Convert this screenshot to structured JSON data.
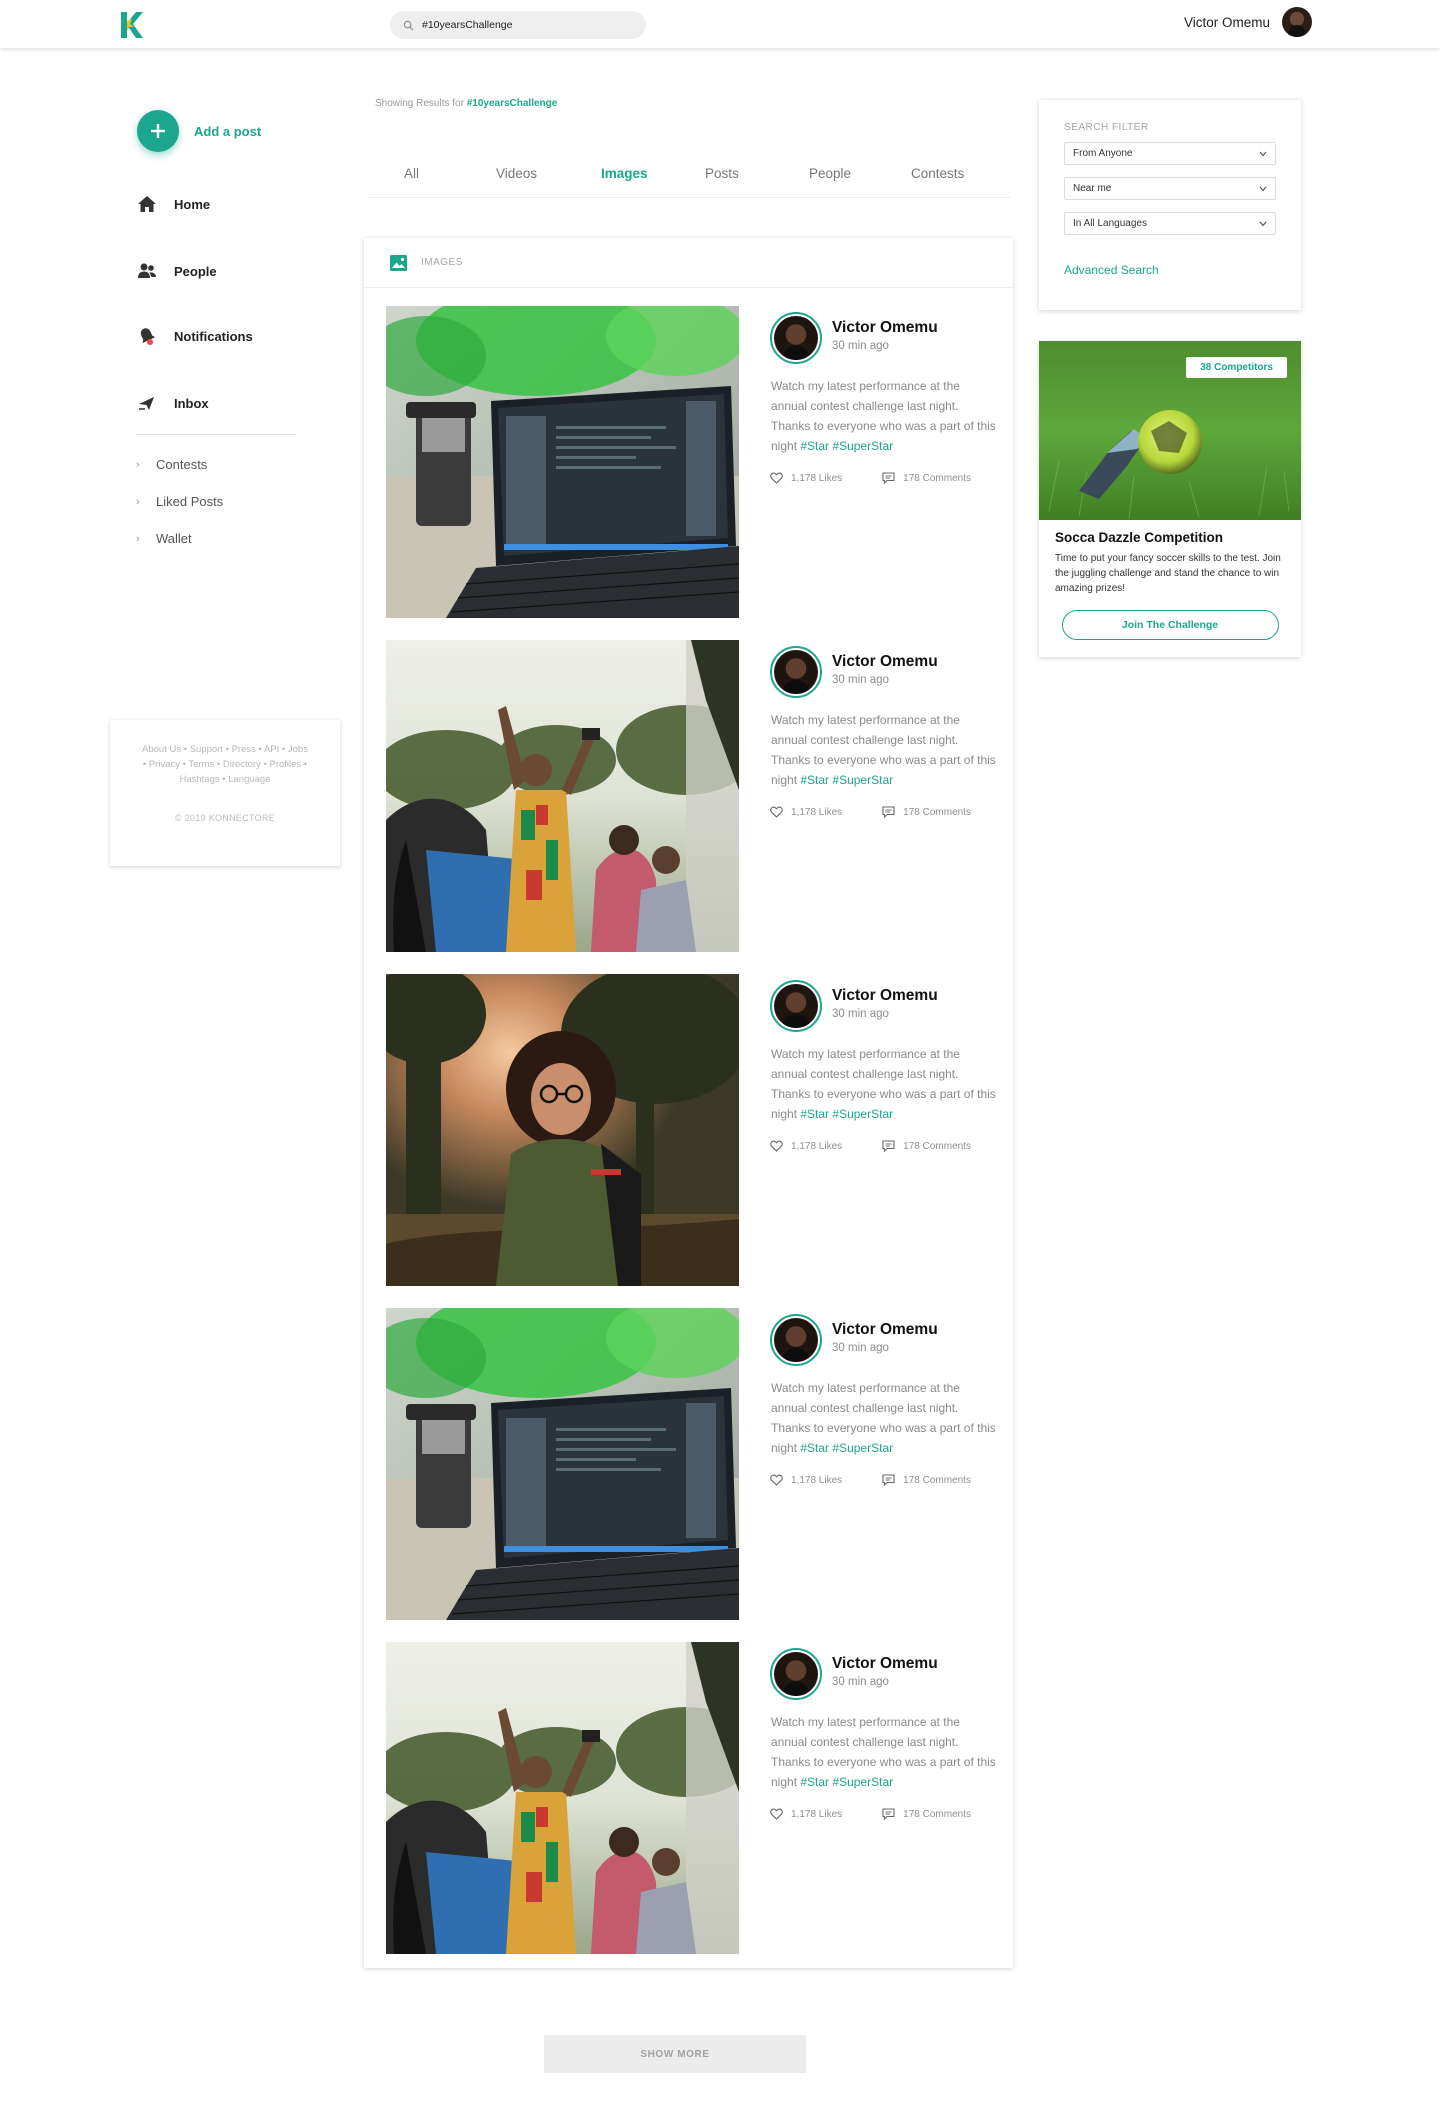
{
  "header": {
    "logo_letter": "K",
    "search_value": "#10yearsChallenge",
    "user_name": "Victor Omemu"
  },
  "sidebar": {
    "add_post_label": "Add a post",
    "nav_items": [
      {
        "label": "Home",
        "icon": "home-icon"
      },
      {
        "label": "People",
        "icon": "people-icon"
      },
      {
        "label": "Notifications",
        "icon": "notifications-icon"
      },
      {
        "label": "Inbox",
        "icon": "inbox-icon"
      }
    ],
    "sub_items": [
      {
        "label": "Contests"
      },
      {
        "label": "Liked Posts"
      },
      {
        "label": "Wallet"
      }
    ],
    "footer": {
      "links_line1": "About Us • Support • Press • API • Jobs",
      "links_line2": "• Privacy • Terms • Directory • Profiles •",
      "links_line3": "Hashtags • Language",
      "copyright": "© 2019 KONNECTORE"
    }
  },
  "results": {
    "showing_prefix": "Showing Results for",
    "query": "#10yearsChallenge",
    "tabs": [
      {
        "label": "All"
      },
      {
        "label": "Videos"
      },
      {
        "label": "Images",
        "active": true
      },
      {
        "label": "Posts"
      },
      {
        "label": "People"
      },
      {
        "label": "Contests"
      }
    ],
    "section_title": "IMAGES",
    "posts": [
      {
        "image": "laptop",
        "author": "Victor Omemu",
        "time": "30 min ago",
        "text": "Watch my latest performance at the annual contest challenge last night. Thanks to everyone who was a part of this night",
        "tag1": "#Star",
        "tag2": "#SuperStar",
        "likes": "1,178 Likes",
        "comments": "178 Comments"
      },
      {
        "image": "crowd",
        "author": "Victor Omemu",
        "time": "30 min ago",
        "text": "Watch my latest performance at the annual contest challenge last night. Thanks to everyone who was a part of this night",
        "tag1": "#Star",
        "tag2": "#SuperStar",
        "likes": "1,178 Likes",
        "comments": "178 Comments"
      },
      {
        "image": "portrait",
        "author": "Victor Omemu",
        "time": "30 min ago",
        "text": "Watch my latest performance at the annual contest challenge last night. Thanks to everyone who was a part of this night",
        "tag1": "#Star",
        "tag2": "#SuperStar",
        "likes": "1,178 Likes",
        "comments": "178 Comments"
      },
      {
        "image": "laptop",
        "author": "Victor Omemu",
        "time": "30 min ago",
        "text": "Watch my latest performance at the annual contest challenge last night. Thanks to everyone who was a part of this night",
        "tag1": "#Star",
        "tag2": "#SuperStar",
        "likes": "1,178 Likes",
        "comments": "178 Comments"
      },
      {
        "image": "crowd",
        "author": "Victor Omemu",
        "time": "30 min ago",
        "text": "Watch my latest performance at the annual contest challenge last night. Thanks to everyone who was a part of this night",
        "tag1": "#Star",
        "tag2": "#SuperStar",
        "likes": "1,178 Likes",
        "comments": "178 Comments"
      }
    ],
    "show_more_label": "SHOW MORE"
  },
  "filter": {
    "title": "SEARCH FILTER",
    "selects": [
      "From Anyone",
      "Near me",
      "In All Languages"
    ],
    "advanced_label": "Advanced Search"
  },
  "contest": {
    "badge": "38 Competitors",
    "title": "Socca Dazzle Competition",
    "description": "Time to put your fancy soccer skills to the test. Join the juggling challenge and stand the chance to win amazing prizes!",
    "button_label": "Join The Challenge"
  },
  "colors": {
    "accent": "#1ca68e",
    "text_dark": "#222222",
    "text_muted": "#8a8a8a"
  }
}
